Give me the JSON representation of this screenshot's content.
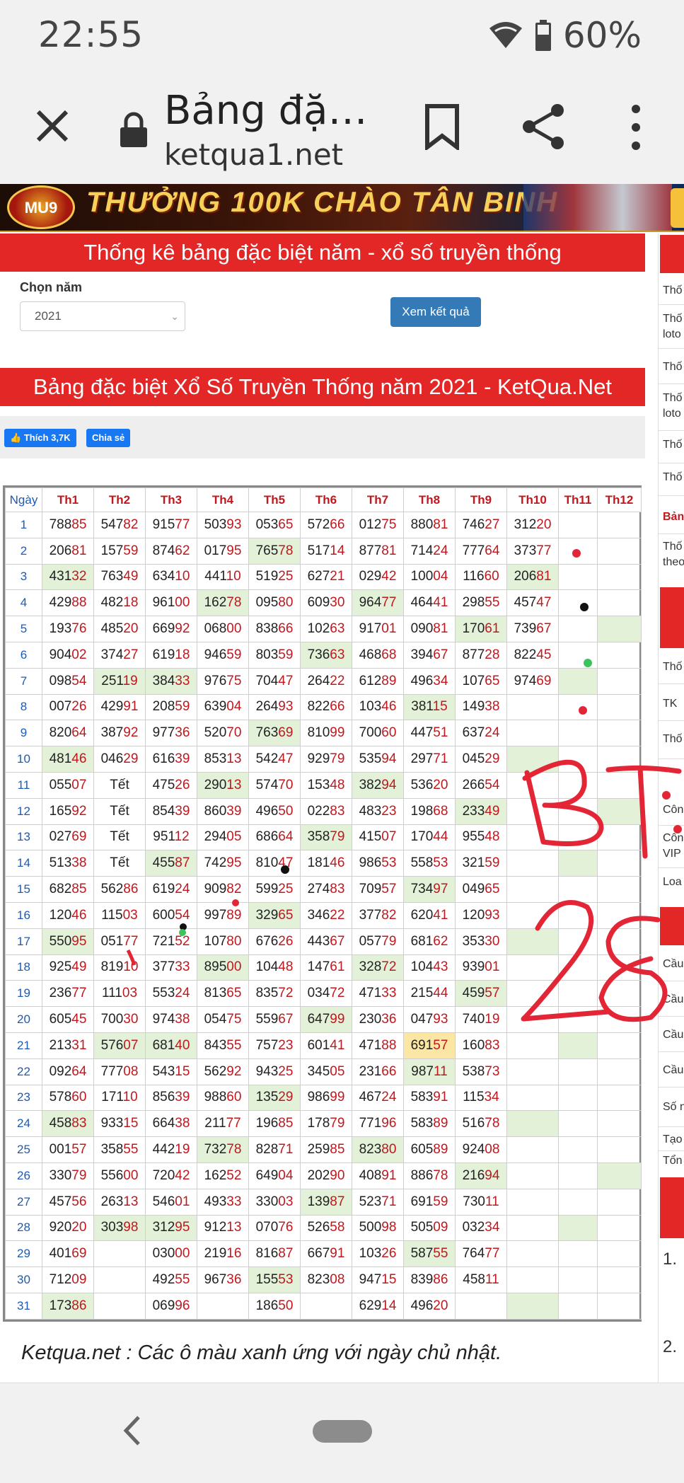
{
  "status": {
    "time": "22:55",
    "battery": "60%"
  },
  "browser": {
    "title": "Bảng đặ…",
    "url": "ketqua1.net"
  },
  "banner": {
    "badge": "MU9",
    "text": "THƯỞNG 100K CHÀO TÂN BINH"
  },
  "stats_header": "Thống kê bảng đặc biệt năm - xổ số truyền thống",
  "year_label": "Chọn năm",
  "year_value": "2021",
  "view_button": "Xem kết quả",
  "table_title": "Bảng đặc biệt Xổ Số Truyền Thống năm 2021 - KetQua.Net",
  "like_label": "Thích 3,7K",
  "share_label": "Chia sẻ",
  "table": {
    "headers": [
      "Ngày",
      "Th1",
      "Th2",
      "Th3",
      "Th4",
      "Th5",
      "Th6",
      "Th7",
      "Th8",
      "Th9",
      "Th10",
      "Th11",
      "Th12"
    ],
    "rows": [
      {
        "day": "1",
        "cells": [
          "78885",
          "54782",
          "91577",
          "50393",
          "05365",
          "57266",
          "01275",
          "88081",
          "74627",
          "31220",
          "",
          ""
        ]
      },
      {
        "day": "2",
        "cells": [
          "20681",
          "15759",
          "87462",
          "01795",
          "76578",
          "51714",
          "87781",
          "71424",
          "77764",
          "37377",
          "",
          ""
        ]
      },
      {
        "day": "3",
        "cells": [
          "43132",
          "76349",
          "63410",
          "44110",
          "51925",
          "62721",
          "02942",
          "10004",
          "11660",
          "20681",
          "",
          ""
        ]
      },
      {
        "day": "4",
        "cells": [
          "42988",
          "48218",
          "96100",
          "16278",
          "09580",
          "60930",
          "96477",
          "46441",
          "29855",
          "45747",
          "",
          ""
        ]
      },
      {
        "day": "5",
        "cells": [
          "19376",
          "48520",
          "66992",
          "06800",
          "83866",
          "10263",
          "91701",
          "09081",
          "17061",
          "73967",
          "",
          ""
        ]
      },
      {
        "day": "6",
        "cells": [
          "90402",
          "37427",
          "61918",
          "94659",
          "80359",
          "73663",
          "46868",
          "39467",
          "87728",
          "82245",
          "",
          ""
        ]
      },
      {
        "day": "7",
        "cells": [
          "09854",
          "25119",
          "38433",
          "97675",
          "70447",
          "26422",
          "61289",
          "49634",
          "10765",
          "97469",
          "",
          ""
        ]
      },
      {
        "day": "8",
        "cells": [
          "00726",
          "42991",
          "20859",
          "63904",
          "26493",
          "82266",
          "10346",
          "38115",
          "14938",
          "",
          "",
          ""
        ]
      },
      {
        "day": "9",
        "cells": [
          "82064",
          "38792",
          "97736",
          "52070",
          "76369",
          "81099",
          "70060",
          "44751",
          "63724",
          "",
          "",
          ""
        ]
      },
      {
        "day": "10",
        "cells": [
          "48146",
          "04629",
          "61639",
          "85313",
          "54247",
          "92979",
          "53594",
          "29771",
          "04529",
          "",
          "",
          ""
        ]
      },
      {
        "day": "11",
        "cells": [
          "05507",
          "Tết",
          "47526",
          "29013",
          "57470",
          "15348",
          "38294",
          "53620",
          "26654",
          "",
          "",
          ""
        ]
      },
      {
        "day": "12",
        "cells": [
          "16592",
          "Tết",
          "85439",
          "86039",
          "49650",
          "02283",
          "48323",
          "19868",
          "23349",
          "",
          "",
          ""
        ]
      },
      {
        "day": "13",
        "cells": [
          "02769",
          "Tết",
          "95112",
          "29405",
          "68664",
          "35879",
          "41507",
          "17044",
          "95548",
          "",
          "",
          ""
        ]
      },
      {
        "day": "14",
        "cells": [
          "51338",
          "Tết",
          "45587",
          "74295",
          "81047",
          "18146",
          "98653",
          "55853",
          "32159",
          "",
          "",
          ""
        ]
      },
      {
        "day": "15",
        "cells": [
          "68285",
          "56286",
          "61924",
          "90982",
          "59925",
          "27483",
          "70957",
          "73497",
          "04965",
          "",
          "",
          ""
        ]
      },
      {
        "day": "16",
        "cells": [
          "12046",
          "11503",
          "60054",
          "99789",
          "32965",
          "34622",
          "37782",
          "62041",
          "12093",
          "",
          "",
          ""
        ]
      },
      {
        "day": "17",
        "cells": [
          "55095",
          "05177",
          "72152",
          "10780",
          "67626",
          "44367",
          "05779",
          "68162",
          "35330",
          "",
          "",
          ""
        ]
      },
      {
        "day": "18",
        "cells": [
          "92549",
          "81910",
          "37733",
          "89500",
          "10448",
          "14761",
          "32872",
          "10443",
          "93901",
          "",
          "",
          ""
        ]
      },
      {
        "day": "19",
        "cells": [
          "23677",
          "11103",
          "55324",
          "81365",
          "83572",
          "03472",
          "47133",
          "21544",
          "45957",
          "",
          "",
          ""
        ]
      },
      {
        "day": "20",
        "cells": [
          "60545",
          "70030",
          "97438",
          "05475",
          "55967",
          "64799",
          "23036",
          "04793",
          "74019",
          "",
          "",
          ""
        ]
      },
      {
        "day": "21",
        "cells": [
          "21331",
          "57607",
          "68140",
          "84355",
          "75723",
          "60141",
          "47188",
          "69157",
          "16083",
          "",
          "",
          ""
        ]
      },
      {
        "day": "22",
        "cells": [
          "09264",
          "77708",
          "54315",
          "56292",
          "94325",
          "34505",
          "23166",
          "98711",
          "53873",
          "",
          "",
          ""
        ]
      },
      {
        "day": "23",
        "cells": [
          "57860",
          "17110",
          "85639",
          "98860",
          "13529",
          "98699",
          "46724",
          "58391",
          "11534",
          "",
          "",
          ""
        ]
      },
      {
        "day": "24",
        "cells": [
          "45883",
          "93315",
          "66438",
          "21177",
          "19685",
          "17879",
          "77196",
          "58389",
          "51678",
          "",
          "",
          ""
        ]
      },
      {
        "day": "25",
        "cells": [
          "00157",
          "35855",
          "44219",
          "73278",
          "82871",
          "25985",
          "82380",
          "60589",
          "92408",
          "",
          "",
          ""
        ]
      },
      {
        "day": "26",
        "cells": [
          "33079",
          "55600",
          "72042",
          "16252",
          "64904",
          "20290",
          "40891",
          "88678",
          "21694",
          "",
          "",
          ""
        ]
      },
      {
        "day": "27",
        "cells": [
          "45756",
          "26313",
          "54601",
          "49333",
          "33003",
          "13987",
          "52371",
          "69159",
          "73011",
          "",
          "",
          ""
        ]
      },
      {
        "day": "28",
        "cells": [
          "92020",
          "30398",
          "31295",
          "91213",
          "07076",
          "52658",
          "50098",
          "50509",
          "03234",
          "",
          "",
          ""
        ]
      },
      {
        "day": "29",
        "cells": [
          "40169",
          "",
          "03000",
          "21916",
          "81687",
          "66791",
          "10326",
          "58755",
          "76477",
          "",
          "",
          ""
        ]
      },
      {
        "day": "30",
        "cells": [
          "71209",
          "",
          "49255",
          "96736",
          "15553",
          "82308",
          "94715",
          "83986",
          "45811",
          "",
          "",
          ""
        ]
      },
      {
        "day": "31",
        "cells": [
          "17386",
          "",
          "06996",
          "",
          "18650",
          "",
          "62914",
          "49620",
          "",
          "",
          "",
          ""
        ]
      }
    ],
    "sunday_cells": [
      [
        2,
        4
      ],
      [
        3,
        0
      ],
      [
        3,
        9
      ],
      [
        4,
        3
      ],
      [
        4,
        6
      ],
      [
        5,
        8
      ],
      [
        5,
        11
      ],
      [
        6,
        5
      ],
      [
        7,
        1
      ],
      [
        7,
        2
      ],
      [
        7,
        10
      ],
      [
        8,
        7
      ],
      [
        9,
        4
      ],
      [
        10,
        0
      ],
      [
        10,
        9
      ],
      [
        11,
        3
      ],
      [
        11,
        6
      ],
      [
        12,
        8
      ],
      [
        12,
        11
      ],
      [
        13,
        5
      ],
      [
        14,
        2
      ],
      [
        14,
        10
      ],
      [
        15,
        7
      ],
      [
        16,
        4
      ],
      [
        17,
        0
      ],
      [
        17,
        9
      ],
      [
        18,
        3
      ],
      [
        18,
        6
      ],
      [
        19,
        8
      ],
      [
        20,
        5
      ],
      [
        21,
        1
      ],
      [
        21,
        2
      ],
      [
        21,
        10
      ],
      [
        22,
        7
      ],
      [
        23,
        4
      ],
      [
        24,
        0
      ],
      [
        24,
        9
      ],
      [
        25,
        3
      ],
      [
        25,
        6
      ],
      [
        26,
        8
      ],
      [
        26,
        11
      ],
      [
        27,
        5
      ],
      [
        28,
        1
      ],
      [
        28,
        2
      ],
      [
        28,
        10
      ],
      [
        29,
        7
      ],
      [
        30,
        4
      ],
      [
        31,
        0
      ],
      [
        31,
        9
      ]
    ],
    "highlight_cell": [
      21,
      7
    ]
  },
  "footnote": "Ketqua.net : Các ô màu xanh ứng với ngày chủ nhật.",
  "sidebar": {
    "items": [
      "Thố",
      "Thố",
      "loto",
      "Thố",
      "Thố",
      "loto",
      "Thố",
      "Thố",
      "Bản",
      "Thố",
      "theo",
      "Thố",
      "TK",
      "Thố",
      "Côn",
      "Côn",
      "VIP",
      "Loa",
      "Cầu",
      "Cầu",
      "Cầu",
      "Cầu",
      "Số n",
      "Tạo",
      "Tổn",
      "1.",
      "2."
    ]
  },
  "annotation": {
    "line1": "BT",
    "line2": "28"
  }
}
